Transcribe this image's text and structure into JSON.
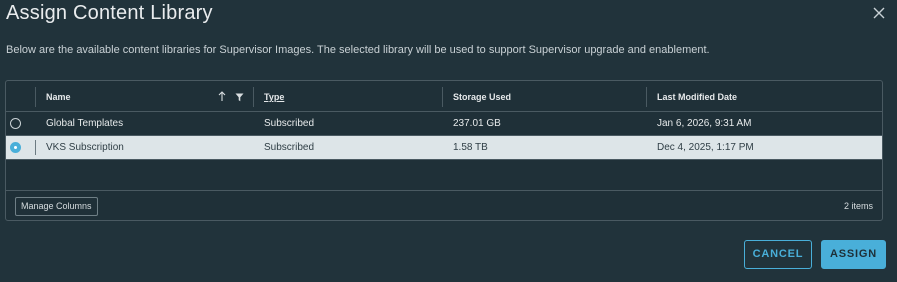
{
  "dialog": {
    "title": "Assign Content Library",
    "description": "Below are the available content libraries for Supervisor Images. The selected library will be used to support Supervisor upgrade and enablement."
  },
  "table": {
    "columns": [
      "Name",
      "Type",
      "Storage Used",
      "Last Modified Date"
    ],
    "rows": [
      {
        "name": "Global Templates",
        "type": "Subscribed",
        "storage": "237.01 GB",
        "modified": "Jan 6, 2026, 9:31 AM",
        "selected": false
      },
      {
        "name": "VKS Subscription",
        "type": "Subscribed",
        "storage": "1.58 TB",
        "modified": "Dec 4, 2025, 1:17 PM",
        "selected": true
      }
    ],
    "manage_columns": "Manage Columns",
    "item_count": "2 items"
  },
  "buttons": {
    "cancel": "CANCEL",
    "assign": "ASSIGN"
  },
  "icons": {
    "close": "close-icon",
    "sort": "sort-arrow-icon",
    "filter": "filter-icon"
  },
  "colors": {
    "background": "#21333b",
    "accent": "#49afd9",
    "selected_row": "#dde5e8"
  }
}
